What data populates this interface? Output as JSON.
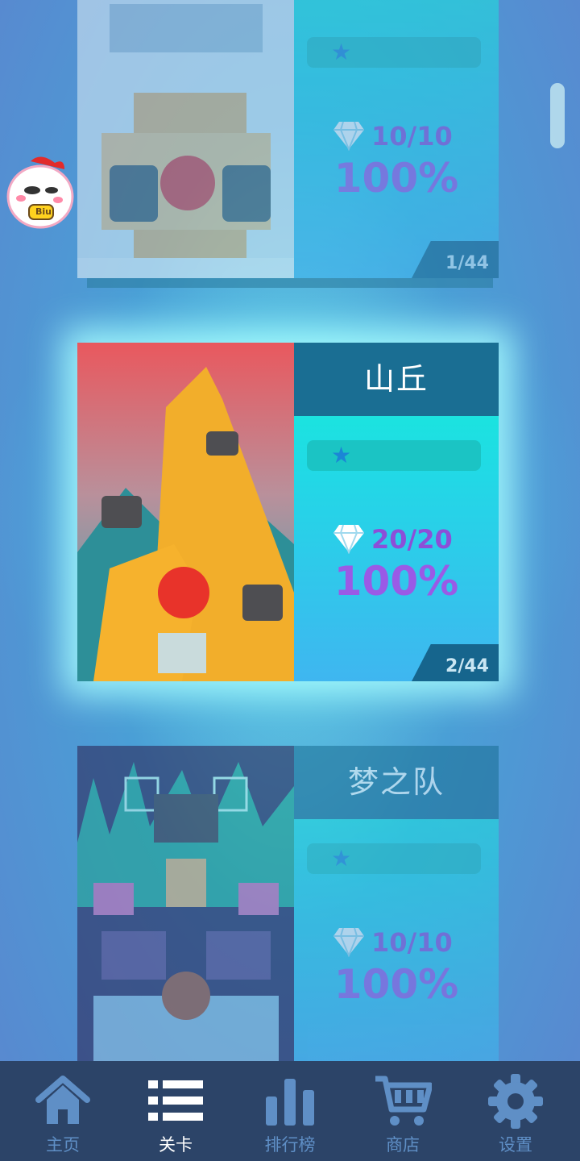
{
  "levels": [
    {
      "title": "",
      "gems": "10/10",
      "percent": "100%",
      "index": "1/44"
    },
    {
      "title": "山丘",
      "gems": "20/20",
      "percent": "100%",
      "index": "2/44"
    },
    {
      "title": "梦之队",
      "gems": "10/10",
      "percent": "100%",
      "index": ""
    }
  ],
  "nav": [
    {
      "label": "主页",
      "icon": "home-icon"
    },
    {
      "label": "关卡",
      "icon": "list-icon"
    },
    {
      "label": "排行榜",
      "icon": "bar-chart-icon"
    },
    {
      "label": "商店",
      "icon": "cart-icon"
    },
    {
      "label": "设置",
      "icon": "gear-icon"
    }
  ],
  "active_nav": "关卡",
  "mascot_text": "Biu",
  "colors": {
    "navbar": "#2c4468",
    "nav_active": "#ffffff",
    "nav_inactive": "#5f8fc6",
    "title_bar": "#1a6e93",
    "gem_text": "#8c4fd8"
  }
}
